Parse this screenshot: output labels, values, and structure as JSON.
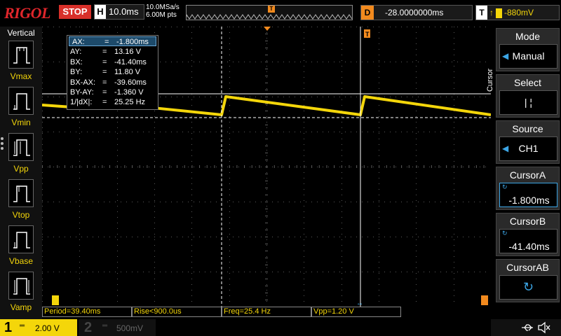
{
  "header": {
    "logo": "RIGOL",
    "run_state": "STOP",
    "timebase_tag": "H",
    "timebase": "10.0ms",
    "sample_rate": "10.0MSa/s",
    "memory_depth": "6.00M pts",
    "trigger_marker": "T",
    "delay_tag": "D",
    "delay": "-28.0000000ms",
    "trigger_tag": "T",
    "trigger_level": "-880mV"
  },
  "left_panel": {
    "title": "Vertical",
    "items": [
      "Vmax",
      "Vmin",
      "Vpp",
      "Vtop",
      "Vbase",
      "Vamp"
    ]
  },
  "cursor_readout": [
    {
      "key": "AX:",
      "value": "-1.800ms"
    },
    {
      "key": "AY:",
      "value": "13.16 V"
    },
    {
      "key": "BX:",
      "value": "-41.40ms"
    },
    {
      "key": "BY:",
      "value": "11.80 V"
    },
    {
      "key": "BX-AX:",
      "value": "-39.60ms"
    },
    {
      "key": "BY-AY:",
      "value": "-1.360 V"
    },
    {
      "key": "1/|dX|:",
      "value": "25.25 Hz"
    }
  ],
  "readout_eq": "=",
  "measurements": [
    {
      "label": "Period=39.40ms"
    },
    {
      "label": "Rise<900.0us"
    },
    {
      "label": "Freq=25.4 Hz"
    },
    {
      "label": "Vpp=1.20 V"
    }
  ],
  "menu": {
    "vertical_title": "Cursor",
    "mode": {
      "title": "Mode",
      "value": "Manual"
    },
    "select": {
      "title": "Select",
      "value": "|   ¦"
    },
    "source": {
      "title": "Source",
      "value": "CH1"
    },
    "cursor_a": {
      "title": "CursorA",
      "value": "-1.800ms"
    },
    "cursor_b": {
      "title": "CursorB",
      "value": "-41.40ms"
    },
    "cursor_ab": {
      "title": "CursorAB"
    }
  },
  "channels": {
    "ch1": {
      "number": "1",
      "scale": "2.00 V"
    },
    "ch2": {
      "number": "2",
      "scale": "500mV"
    }
  },
  "colors": {
    "ch1": "#f4d60a",
    "trigger": "#f28a1e",
    "stop": "#d8302a",
    "grid": "#5a5a5a",
    "accent": "#3ca6e6"
  },
  "icons": {
    "usb": "usb-icon",
    "sound": "mute-speaker-icon"
  }
}
